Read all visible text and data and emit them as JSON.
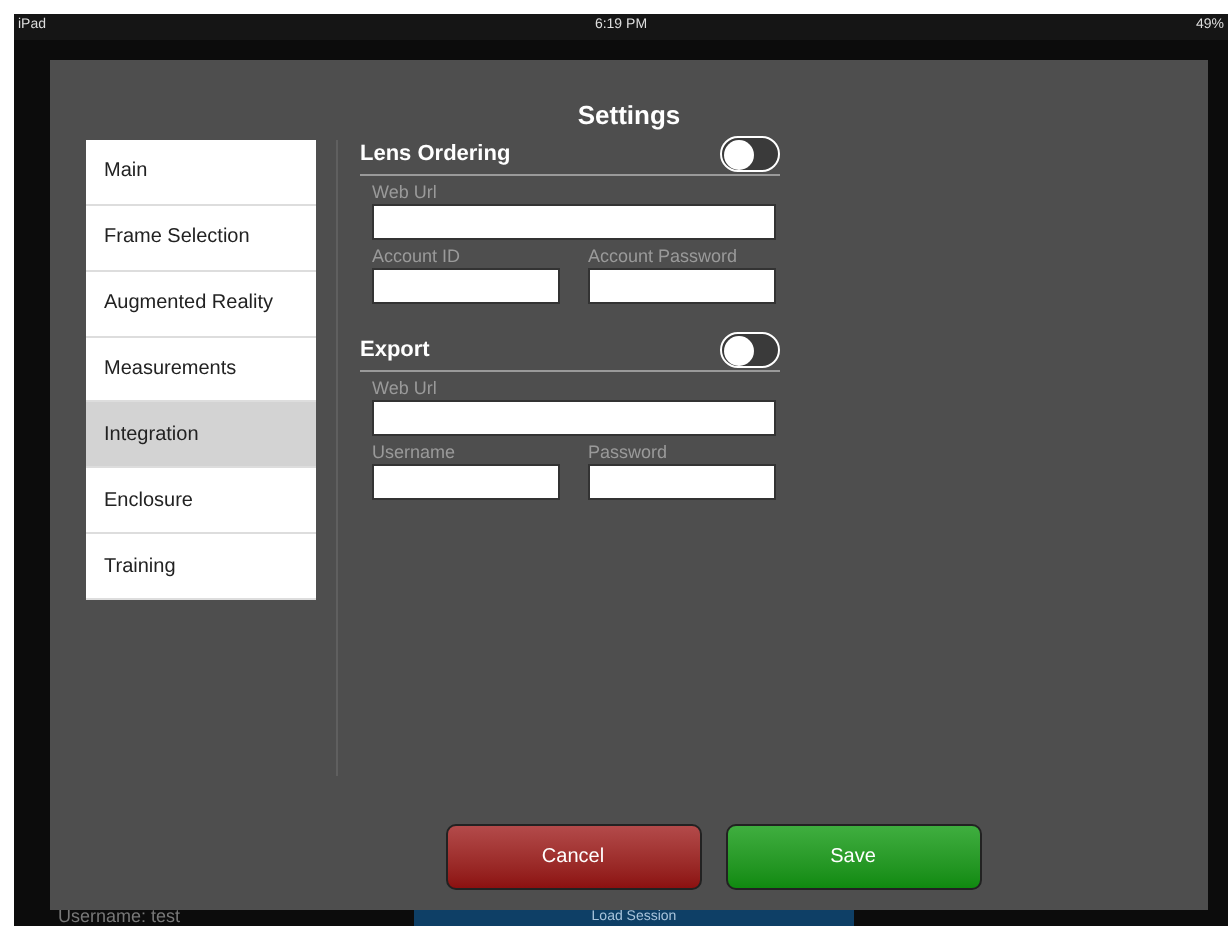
{
  "status_bar": {
    "device": "iPad",
    "time": "6:19 PM",
    "battery": "49%"
  },
  "background": {
    "username": "Username: test",
    "session_button": "Load Session"
  },
  "dialog": {
    "title": "Settings",
    "sidebar": {
      "items": [
        {
          "label": "Main",
          "selected": false
        },
        {
          "label": "Frame Selection",
          "selected": false
        },
        {
          "label": "Augmented Reality",
          "selected": false
        },
        {
          "label": "Measurements",
          "selected": false
        },
        {
          "label": "Integration",
          "selected": true
        },
        {
          "label": "Enclosure",
          "selected": false
        },
        {
          "label": "Training",
          "selected": false
        }
      ]
    },
    "sections": [
      {
        "title": "Lens Ordering",
        "on": false,
        "fields": [
          {
            "label": "Web Url",
            "kind": "full"
          },
          {
            "label": "Account ID",
            "kind": "half"
          },
          {
            "label": "Account Password",
            "kind": "half"
          }
        ]
      },
      {
        "title": "Export",
        "on": false,
        "fields": [
          {
            "label": "Web Url",
            "kind": "full"
          },
          {
            "label": "Username",
            "kind": "half"
          },
          {
            "label": "Password",
            "kind": "half"
          }
        ]
      }
    ],
    "buttons": [
      {
        "label": "Cancel",
        "kind": "cancel"
      },
      {
        "label": "Save",
        "kind": "save"
      }
    ]
  }
}
